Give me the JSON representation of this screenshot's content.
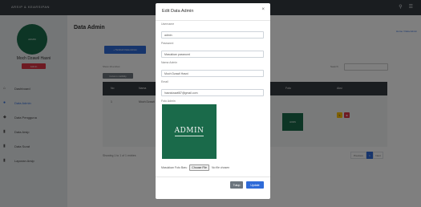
{
  "topbar": {
    "brand": "ARSIP & KEARSIPAN",
    "search_icon": "search-icon",
    "menu_icon": "hamburger-icon"
  },
  "sidebar": {
    "logo_text": "ADMIN",
    "user_name": "Moch Dzawil Hasni",
    "user_role": "Admin",
    "items": [
      {
        "icon": "home-icon",
        "glyph": "⌂",
        "label": "Dashboard"
      },
      {
        "icon": "users-icon",
        "glyph": "●",
        "label": "Data Admin"
      },
      {
        "icon": "user-group-icon",
        "glyph": "◆",
        "label": "Data Pengguna"
      },
      {
        "icon": "file-icon",
        "glyph": "▮",
        "label": "Data Arsip"
      },
      {
        "icon": "document-icon",
        "glyph": "▮",
        "label": "Data Surat"
      },
      {
        "icon": "report-icon",
        "glyph": "▮",
        "label": "Laporan Arsip"
      }
    ]
  },
  "main": {
    "title": "Data Admin",
    "breadcrumb": "Home / Data Admin",
    "add_button": "+ Tambah Data Admin",
    "show_label": "Show 10 entries",
    "search_label": "Search:",
    "column_button": "Column visibility",
    "table": {
      "headers": [
        "No",
        "Nama",
        "Foto",
        "Aksi"
      ],
      "rows": [
        {
          "no": "1",
          "nama": "Moch Dzawil Hasni",
          "foto": "ADMIN"
        }
      ]
    },
    "info": "Showing 1 to 1 of 1 entries",
    "pager": {
      "prev": "Previous",
      "current": "1",
      "next": "Next"
    }
  },
  "modal": {
    "title": "Edit Data Admin",
    "fields": {
      "username": {
        "label": "Username",
        "value": "admin"
      },
      "password": {
        "label": "Password",
        "value": "Masukkan password"
      },
      "nama": {
        "label": "Nama Admin",
        "value": "Moch Dzawil Hasni"
      },
      "email": {
        "label": "Email",
        "value": "hasnidzawil87@gmail.com"
      }
    },
    "photo_label": "Foto Admin",
    "photo_text": "ADMIN",
    "file_label": "Masukkan Foto Baru",
    "file_button": "Choose File",
    "file_status": "No file chosen",
    "close_button": "Tutup",
    "update_button": "Update"
  }
}
